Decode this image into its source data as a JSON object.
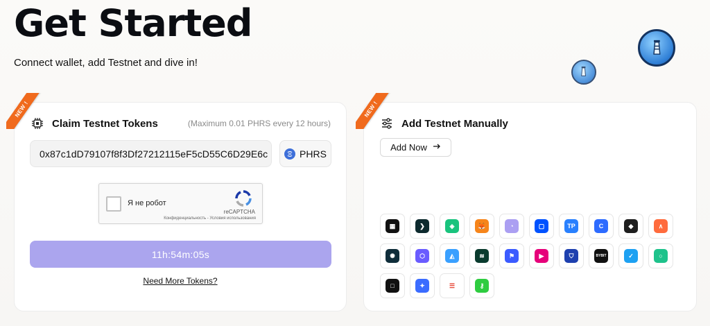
{
  "header": {
    "title": "Get Started",
    "subtitle": "Connect wallet, add Testnet and dive in!"
  },
  "claim_card": {
    "ribbon": "NEW !",
    "title": "Claim Testnet Tokens",
    "note": "(Maximum 0.01 PHRS every 12 hours)",
    "address": "0x87c1dD79107f8f3Df27212115eF5cD55C6D29E6c",
    "token": "PHRS",
    "captcha": {
      "label": "Я не робот",
      "brand": "reCAPTCHA",
      "terms": "Конфиденциальность - Условия использования"
    },
    "timer": "11h:54m:05s",
    "more_link": "Need More Tokens?"
  },
  "manual_card": {
    "ribbon": "NEW !",
    "title": "Add Testnet Manually",
    "add_button": "Add Now",
    "wallets": [
      {
        "icon": "okx-wallet-icon",
        "bg": "#111111",
        "glyph": "▦"
      },
      {
        "icon": "arrow-wallet-icon",
        "bg": "#0d2a2e",
        "glyph": "❯"
      },
      {
        "icon": "diamond-wallet-icon",
        "bg": "#19c37d",
        "glyph": "◈"
      },
      {
        "icon": "metamask-icon",
        "bg": "#f6851b",
        "glyph": "🦊"
      },
      {
        "icon": "phantom-icon",
        "bg": "#ab9ff2",
        "glyph": "◔"
      },
      {
        "icon": "coinbase-wallet-icon",
        "bg": "#0052ff",
        "glyph": "▢"
      },
      {
        "icon": "tp-wallet-icon",
        "bg": "#2980fe",
        "glyph": "TP"
      },
      {
        "icon": "c-wallet-icon",
        "bg": "#2d6bff",
        "glyph": "C"
      },
      {
        "icon": "binance-wallet-icon",
        "bg": "#1e1e1e",
        "glyph": "◆"
      },
      {
        "icon": "arc-wallet-icon",
        "bg": "#ff6b3d",
        "glyph": "∧"
      },
      {
        "icon": "dots-wallet-icon",
        "bg": "#0f2d3a",
        "glyph": "✺"
      },
      {
        "icon": "hex-wallet-icon",
        "bg": "#6a5cff",
        "glyph": "⬡"
      },
      {
        "icon": "cube-wallet-icon",
        "bg": "#3aa0ff",
        "glyph": "◭"
      },
      {
        "icon": "waves-wallet-icon",
        "bg": "#0a3b2e",
        "glyph": "≋"
      },
      {
        "icon": "flag-wallet-icon",
        "bg": "#3b5bff",
        "glyph": "⚑"
      },
      {
        "icon": "play-wallet-icon",
        "bg": "#e6007a",
        "glyph": "▶"
      },
      {
        "icon": "shield-wallet-icon",
        "bg": "#1e40af",
        "glyph": "⛉"
      },
      {
        "icon": "bybit-wallet-icon",
        "bg": "#111111",
        "glyph": "BYBIT"
      },
      {
        "icon": "check-wallet-icon",
        "bg": "#1da1f2",
        "glyph": "✓"
      },
      {
        "icon": "ring-wallet-icon",
        "bg": "#1ec28b",
        "glyph": "○"
      },
      {
        "icon": "square-wallet-icon",
        "bg": "#111111",
        "glyph": "□"
      },
      {
        "icon": "star-wallet-icon",
        "bg": "#3b6cff",
        "glyph": "✦"
      },
      {
        "icon": "stripes-wallet-icon",
        "bg": "#ffffff",
        "glyph": "☰"
      },
      {
        "icon": "key-wallet-icon",
        "bg": "#2ecc40",
        "glyph": "⚷"
      }
    ]
  }
}
